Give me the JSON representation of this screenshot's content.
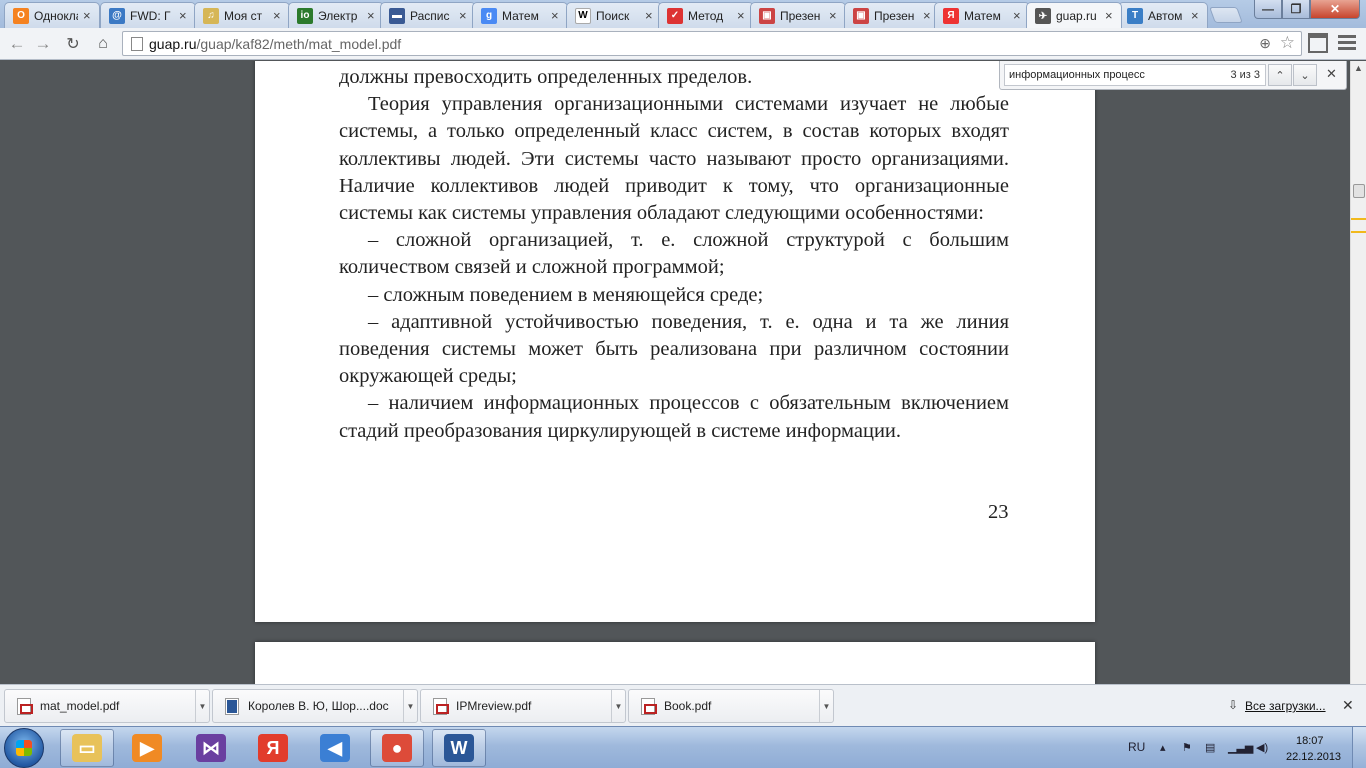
{
  "browser": {
    "tabs": [
      {
        "label": "Одноклассники",
        "icon": "ok-icon",
        "color": "#f58220",
        "glyph": "О"
      },
      {
        "label": "FWD: Г",
        "icon": "mail-icon",
        "color": "#3b79c4",
        "glyph": "@"
      },
      {
        "label": "Моя ст",
        "icon": "page-icon",
        "color": "#d6b656",
        "glyph": "♫"
      },
      {
        "label": "Электр",
        "icon": "io-icon",
        "color": "#2c7a2c",
        "glyph": "io"
      },
      {
        "label": "Распис",
        "icon": "schedule-icon",
        "color": "#3a5a94",
        "glyph": "▬"
      },
      {
        "label": "Матем",
        "icon": "google-icon",
        "color": "#4a8af4",
        "glyph": "g"
      },
      {
        "label": "Поиск",
        "icon": "wikipedia-icon",
        "color": "#ffffff",
        "glyph": "W"
      },
      {
        "label": "Метод",
        "icon": "method-icon",
        "color": "#d33",
        "glyph": "✓"
      },
      {
        "label": "Презен",
        "icon": "presentation-icon",
        "color": "#c44",
        "glyph": "▣"
      },
      {
        "label": "Презен",
        "icon": "presentation-icon",
        "color": "#c44",
        "glyph": "▣"
      },
      {
        "label": "Матем",
        "icon": "yandex-icon",
        "color": "#e33",
        "glyph": "Я"
      },
      {
        "label": "guap.ru",
        "icon": "guap-icon",
        "color": "#555",
        "glyph": "✈",
        "active": true
      },
      {
        "label": "Автом",
        "icon": "translate-icon",
        "color": "#3a7ec6",
        "glyph": "T"
      }
    ],
    "url": {
      "host": "guap.ru",
      "path": "/guap/kaf82/meth/mat_model.pdf"
    }
  },
  "find": {
    "query": "информационных процесс",
    "count": "3 из 3"
  },
  "document": {
    "paragraphs": [
      {
        "text": "должны превосходить определенных пределов.",
        "indent": false
      },
      {
        "text": "Теория управления организационными системами изучает не любые системы, а только определенный класс систем, в состав которых входят коллективы людей. Эти системы часто называют просто организациями. Наличие коллективов людей приводит к тому, что организационные системы как системы управления обладают следующими особенностями:",
        "indent": true
      },
      {
        "text": "– сложной организацией, т.  е. сложной структурой с большим количеством связей и сложной программой;",
        "indent": true
      },
      {
        "text": "– сложным поведением в меняющейся среде;",
        "indent": true
      },
      {
        "text": "– адаптивной устойчивостью поведения, т. е. одна и та же линия поведения системы может быть реализована при различном состоянии окружающей среды;",
        "indent": true
      },
      {
        "text": "– наличием информационных процессов с обязательным включением стадий преобразования циркулирующей в системе информации.",
        "indent": true
      }
    ],
    "page_number": "23"
  },
  "downloads": {
    "items": [
      {
        "name": "mat_model.pdf",
        "type": "pdf"
      },
      {
        "name": "Королев В. Ю, Шор....doc",
        "type": "doc"
      },
      {
        "name": "IPMreview.pdf",
        "type": "pdf"
      },
      {
        "name": "Book.pdf",
        "type": "pdf"
      }
    ],
    "all_label": "Все загрузки..."
  },
  "taskbar": {
    "apps": [
      {
        "name": "explorer",
        "icon": "folder-icon",
        "color": "#e8c25a",
        "glyph": "▭"
      },
      {
        "name": "media-player",
        "icon": "media-player-icon",
        "color": "#f08a24",
        "glyph": "▶"
      },
      {
        "name": "visual-studio",
        "icon": "visual-studio-icon",
        "color": "#6a3fa0",
        "glyph": "⋈"
      },
      {
        "name": "yandex",
        "icon": "yandex-icon",
        "color": "#e23c2c",
        "glyph": "Я"
      },
      {
        "name": "volume",
        "icon": "speaker-icon",
        "color": "#3b7fd4",
        "glyph": "◀"
      },
      {
        "name": "chrome",
        "icon": "chrome-icon",
        "color": "#dd4b39",
        "glyph": "●"
      },
      {
        "name": "word",
        "icon": "word-icon",
        "color": "#2b5797",
        "glyph": "W"
      }
    ],
    "lang": "RU",
    "time": "18:07",
    "date": "22.12.2013"
  }
}
